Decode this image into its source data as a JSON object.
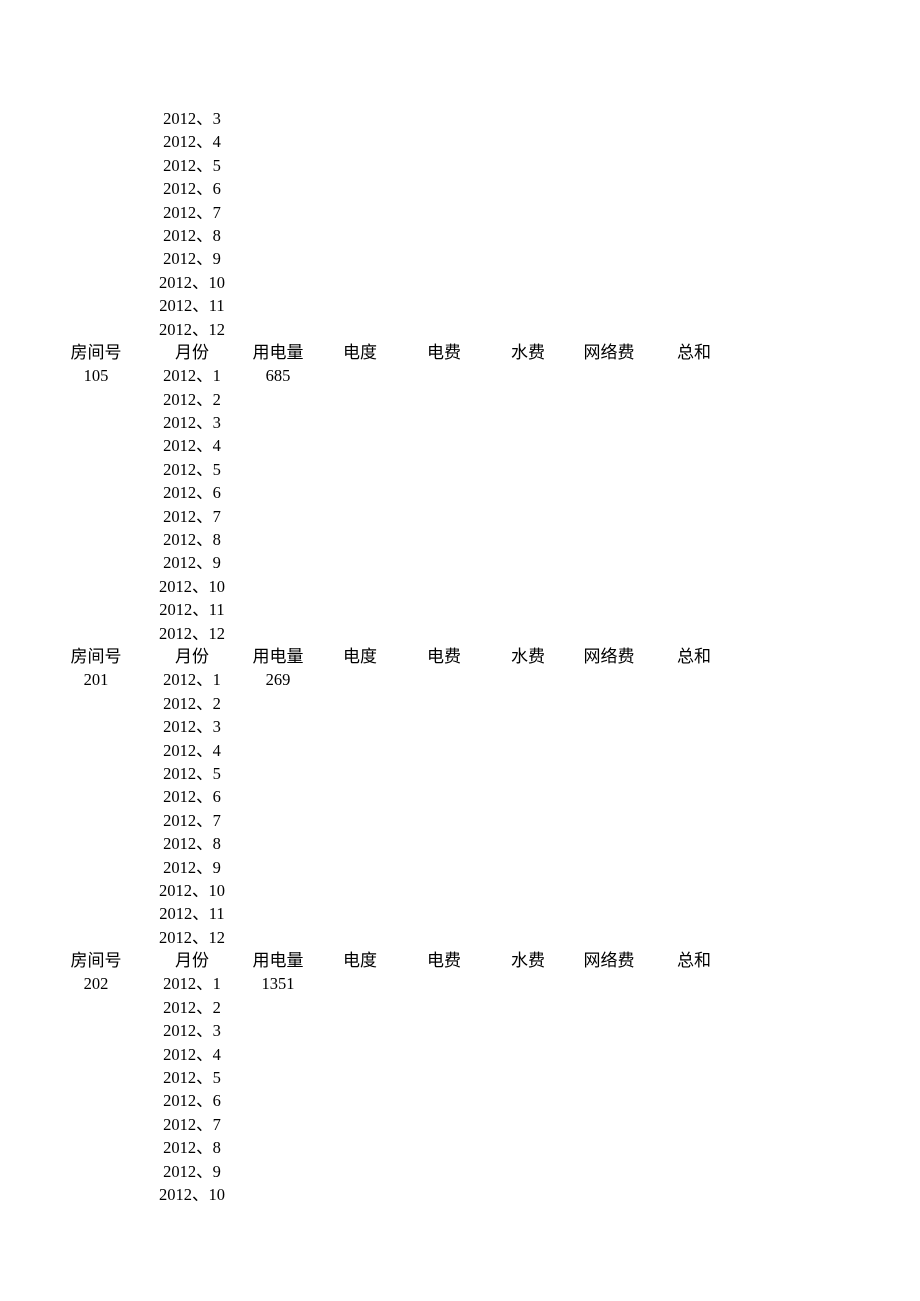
{
  "document": {
    "kind": "utility-billing-table",
    "page_background": "#ffffff",
    "text_color": "#000000"
  },
  "columns": {
    "room": "房间号",
    "month": "月份",
    "usage": "用电量",
    "rate": "电度",
    "electric_fee": "电费",
    "water_fee": "水费",
    "network_fee": "网络费",
    "total": "总和"
  },
  "continued_block": {
    "note": "rows continuing from previous page (room number and header not visible)",
    "rows": [
      {
        "room": "",
        "month": "2012、3",
        "usage": "",
        "rate": "",
        "electric_fee": "",
        "water_fee": "",
        "network_fee": "",
        "total": ""
      },
      {
        "room": "",
        "month": "2012、4",
        "usage": "",
        "rate": "",
        "electric_fee": "",
        "water_fee": "",
        "network_fee": "",
        "total": ""
      },
      {
        "room": "",
        "month": "2012、5",
        "usage": "",
        "rate": "",
        "electric_fee": "",
        "water_fee": "",
        "network_fee": "",
        "total": ""
      },
      {
        "room": "",
        "month": "2012、6",
        "usage": "",
        "rate": "",
        "electric_fee": "",
        "water_fee": "",
        "network_fee": "",
        "total": ""
      },
      {
        "room": "",
        "month": "2012、7",
        "usage": "",
        "rate": "",
        "electric_fee": "",
        "water_fee": "",
        "network_fee": "",
        "total": ""
      },
      {
        "room": "",
        "month": "2012、8",
        "usage": "",
        "rate": "",
        "electric_fee": "",
        "water_fee": "",
        "network_fee": "",
        "total": ""
      },
      {
        "room": "",
        "month": "2012、9",
        "usage": "",
        "rate": "",
        "electric_fee": "",
        "water_fee": "",
        "network_fee": "",
        "total": ""
      },
      {
        "room": "",
        "month": "2012、10",
        "usage": "",
        "rate": "",
        "electric_fee": "",
        "water_fee": "",
        "network_fee": "",
        "total": ""
      },
      {
        "room": "",
        "month": "2012、11",
        "usage": "",
        "rate": "",
        "electric_fee": "",
        "water_fee": "",
        "network_fee": "",
        "total": ""
      },
      {
        "room": "",
        "month": "2012、12",
        "usage": "",
        "rate": "",
        "electric_fee": "",
        "water_fee": "",
        "network_fee": "",
        "total": ""
      }
    ]
  },
  "blocks": [
    {
      "room_number": "105",
      "rows": [
        {
          "room": "105",
          "month": "2012、1",
          "usage": "685",
          "rate": "",
          "electric_fee": "",
          "water_fee": "",
          "network_fee": "",
          "total": ""
        },
        {
          "room": "",
          "month": "2012、2",
          "usage": "",
          "rate": "",
          "electric_fee": "",
          "water_fee": "",
          "network_fee": "",
          "total": ""
        },
        {
          "room": "",
          "month": "2012、3",
          "usage": "",
          "rate": "",
          "electric_fee": "",
          "water_fee": "",
          "network_fee": "",
          "total": ""
        },
        {
          "room": "",
          "month": "2012、4",
          "usage": "",
          "rate": "",
          "electric_fee": "",
          "water_fee": "",
          "network_fee": "",
          "total": ""
        },
        {
          "room": "",
          "month": "2012、5",
          "usage": "",
          "rate": "",
          "electric_fee": "",
          "water_fee": "",
          "network_fee": "",
          "total": ""
        },
        {
          "room": "",
          "month": "2012、6",
          "usage": "",
          "rate": "",
          "electric_fee": "",
          "water_fee": "",
          "network_fee": "",
          "total": ""
        },
        {
          "room": "",
          "month": "2012、7",
          "usage": "",
          "rate": "",
          "electric_fee": "",
          "water_fee": "",
          "network_fee": "",
          "total": ""
        },
        {
          "room": "",
          "month": "2012、8",
          "usage": "",
          "rate": "",
          "electric_fee": "",
          "water_fee": "",
          "network_fee": "",
          "total": ""
        },
        {
          "room": "",
          "month": "2012、9",
          "usage": "",
          "rate": "",
          "electric_fee": "",
          "water_fee": "",
          "network_fee": "",
          "total": ""
        },
        {
          "room": "",
          "month": "2012、10",
          "usage": "",
          "rate": "",
          "electric_fee": "",
          "water_fee": "",
          "network_fee": "",
          "total": ""
        },
        {
          "room": "",
          "month": "2012、11",
          "usage": "",
          "rate": "",
          "electric_fee": "",
          "water_fee": "",
          "network_fee": "",
          "total": ""
        },
        {
          "room": "",
          "month": "2012、12",
          "usage": "",
          "rate": "",
          "electric_fee": "",
          "water_fee": "",
          "network_fee": "",
          "total": ""
        }
      ]
    },
    {
      "room_number": "201",
      "rows": [
        {
          "room": "201",
          "month": "2012、1",
          "usage": "269",
          "rate": "",
          "electric_fee": "",
          "water_fee": "",
          "network_fee": "",
          "total": ""
        },
        {
          "room": "",
          "month": "2012、2",
          "usage": "",
          "rate": "",
          "electric_fee": "",
          "water_fee": "",
          "network_fee": "",
          "total": ""
        },
        {
          "room": "",
          "month": "2012、3",
          "usage": "",
          "rate": "",
          "electric_fee": "",
          "water_fee": "",
          "network_fee": "",
          "total": ""
        },
        {
          "room": "",
          "month": "2012、4",
          "usage": "",
          "rate": "",
          "electric_fee": "",
          "water_fee": "",
          "network_fee": "",
          "total": ""
        },
        {
          "room": "",
          "month": "2012、5",
          "usage": "",
          "rate": "",
          "electric_fee": "",
          "water_fee": "",
          "network_fee": "",
          "total": ""
        },
        {
          "room": "",
          "month": "2012、6",
          "usage": "",
          "rate": "",
          "electric_fee": "",
          "water_fee": "",
          "network_fee": "",
          "total": ""
        },
        {
          "room": "",
          "month": "2012、7",
          "usage": "",
          "rate": "",
          "electric_fee": "",
          "water_fee": "",
          "network_fee": "",
          "total": ""
        },
        {
          "room": "",
          "month": "2012、8",
          "usage": "",
          "rate": "",
          "electric_fee": "",
          "water_fee": "",
          "network_fee": "",
          "total": ""
        },
        {
          "room": "",
          "month": "2012、9",
          "usage": "",
          "rate": "",
          "electric_fee": "",
          "water_fee": "",
          "network_fee": "",
          "total": ""
        },
        {
          "room": "",
          "month": "2012、10",
          "usage": "",
          "rate": "",
          "electric_fee": "",
          "water_fee": "",
          "network_fee": "",
          "total": ""
        },
        {
          "room": "",
          "month": "2012、11",
          "usage": "",
          "rate": "",
          "electric_fee": "",
          "water_fee": "",
          "network_fee": "",
          "total": ""
        },
        {
          "room": "",
          "month": "2012、12",
          "usage": "",
          "rate": "",
          "electric_fee": "",
          "water_fee": "",
          "network_fee": "",
          "total": ""
        }
      ]
    },
    {
      "room_number": "202",
      "rows": [
        {
          "room": "202",
          "month": "2012、1",
          "usage": "1351",
          "rate": "",
          "electric_fee": "",
          "water_fee": "",
          "network_fee": "",
          "total": ""
        },
        {
          "room": "",
          "month": "2012、2",
          "usage": "",
          "rate": "",
          "electric_fee": "",
          "water_fee": "",
          "network_fee": "",
          "total": ""
        },
        {
          "room": "",
          "month": "2012、3",
          "usage": "",
          "rate": "",
          "electric_fee": "",
          "water_fee": "",
          "network_fee": "",
          "total": ""
        },
        {
          "room": "",
          "month": "2012、4",
          "usage": "",
          "rate": "",
          "electric_fee": "",
          "water_fee": "",
          "network_fee": "",
          "total": ""
        },
        {
          "room": "",
          "month": "2012、5",
          "usage": "",
          "rate": "",
          "electric_fee": "",
          "water_fee": "",
          "network_fee": "",
          "total": ""
        },
        {
          "room": "",
          "month": "2012、6",
          "usage": "",
          "rate": "",
          "electric_fee": "",
          "water_fee": "",
          "network_fee": "",
          "total": ""
        },
        {
          "room": "",
          "month": "2012、7",
          "usage": "",
          "rate": "",
          "electric_fee": "",
          "water_fee": "",
          "network_fee": "",
          "total": ""
        },
        {
          "room": "",
          "month": "2012、8",
          "usage": "",
          "rate": "",
          "electric_fee": "",
          "water_fee": "",
          "network_fee": "",
          "total": ""
        },
        {
          "room": "",
          "month": "2012、9",
          "usage": "",
          "rate": "",
          "electric_fee": "",
          "water_fee": "",
          "network_fee": "",
          "total": ""
        },
        {
          "room": "",
          "month": "2012、10",
          "usage": "",
          "rate": "",
          "electric_fee": "",
          "water_fee": "",
          "network_fee": "",
          "total": ""
        }
      ]
    }
  ]
}
